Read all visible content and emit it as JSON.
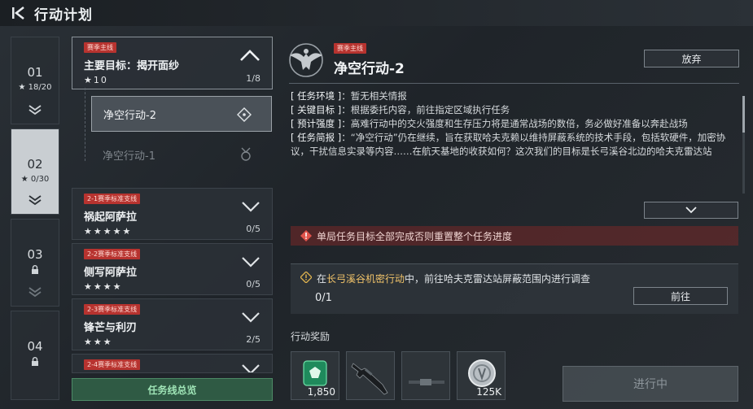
{
  "header": {
    "title": "行动计划"
  },
  "chapters": [
    {
      "num": "01",
      "progress": "★ 18/20",
      "locked": false
    },
    {
      "num": "02",
      "progress": "★ 0/30",
      "locked": false
    },
    {
      "num": "03",
      "progress": "",
      "locked": true
    },
    {
      "num": "04",
      "progress": "",
      "locked": true
    }
  ],
  "missions": {
    "main": {
      "tag": "赛季主线",
      "name": "主要目标：揭开面纱",
      "stars": "★10",
      "count": "1/8"
    },
    "subs": [
      {
        "name": "净空行动-2"
      },
      {
        "name": "净空行动-1"
      }
    ],
    "branches": [
      {
        "tag": "2-1赛季标准支线",
        "name": "祸起阿萨拉",
        "stars": "★★★★★",
        "count": "0/5"
      },
      {
        "tag": "2-2赛季标准支线",
        "name": "侧写阿萨拉",
        "stars": "★★★★",
        "count": "0/5"
      },
      {
        "tag": "2-3赛季标准支线",
        "name": "锋芒与利刃",
        "stars": "★★★",
        "count": "2/5"
      },
      {
        "tag": "2-4赛季标准支线",
        "name": "",
        "stars": "",
        "count": ""
      }
    ],
    "overview_label": "任务线总览"
  },
  "detail": {
    "tag": "赛季主线",
    "title": "净空行动-2",
    "abandon_label": "放弃",
    "env_key": "[ 任务环境 ]",
    "env_val": "：暂无相关情报",
    "target_key": "[ 关键目标 ]",
    "target_val": "：根据委托内容，前往指定区域执行任务",
    "intensity_key": "[ 预计强度 ]",
    "intensity_val": "：高难行动中的交火强度和生存压力将是通常战场的数倍，务必做好准备以奔赴战场",
    "brief_key": "[ 任务简报 ]",
    "brief_val": "：“净空行动”仍在继续，旨在获取哈夫克赖以维持屏蔽系统的技术手段，包括软硬件，加密协议，干扰信息实录等内容……在航天基地的收获如何？这次我们的目标是长弓溪谷北边的哈夫克雷达站",
    "warning": "单局任务目标全部完成否则重置整个任务进度",
    "task_prefix": "在",
    "task_highlight": "长弓溪谷机密行动",
    "task_suffix": "中，前往哈夫克雷达站屏蔽范围内进行调查",
    "task_progress": "0/1",
    "goto_label": "前往",
    "rewards_label": "行动奖励",
    "rewards": [
      {
        "icon": "green-token-icon",
        "amount": "1,850"
      },
      {
        "icon": "rifle-icon",
        "amount": ""
      },
      {
        "icon": "scope-rail-icon",
        "amount": ""
      },
      {
        "icon": "silver-coin-icon",
        "amount": "125K"
      }
    ],
    "status_label": "进行中"
  },
  "colors": {
    "tag_red": "#b7332f",
    "highlight": "#f2c46a",
    "overview_green": "#2f5a44"
  }
}
